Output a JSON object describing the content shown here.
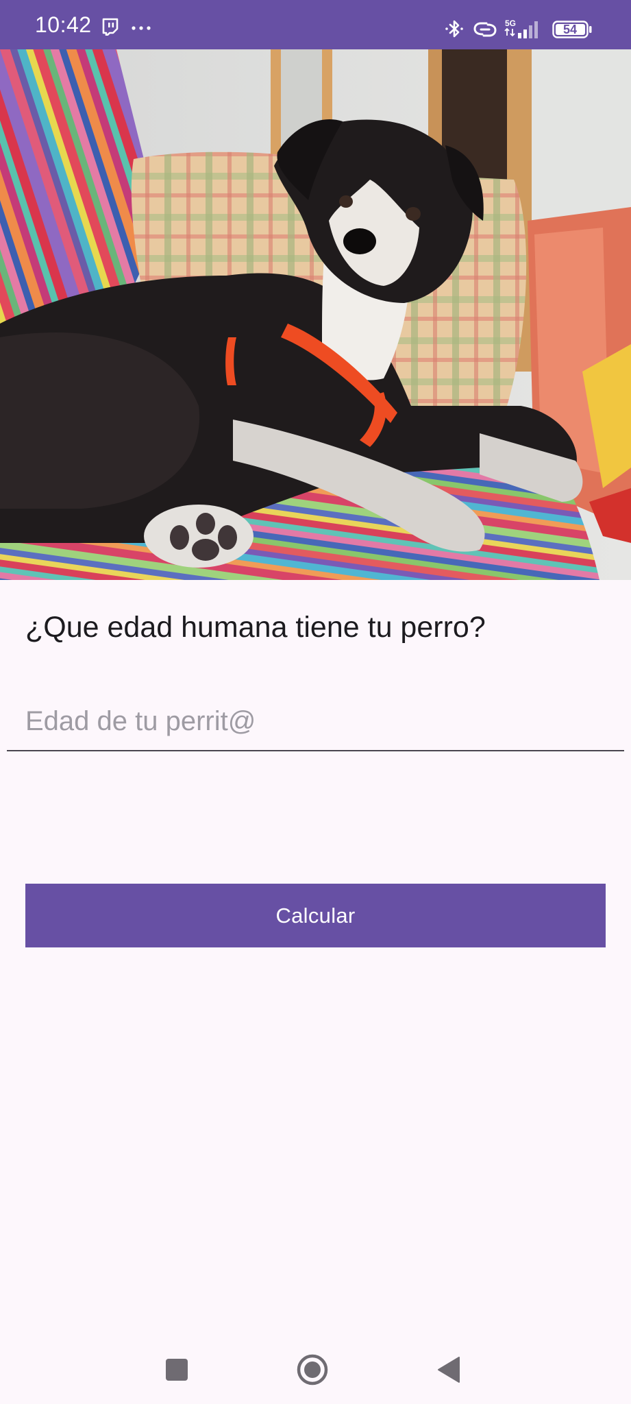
{
  "status_bar": {
    "time": "10:42",
    "network": "5G",
    "battery": "54",
    "icons": [
      "twitch-notification-icon",
      "more-dots-icon",
      "bluetooth-icon",
      "link-icon",
      "signal-icon",
      "battery-icon"
    ],
    "background_color": "#6750a4"
  },
  "photo": {
    "subject": "dog-photo"
  },
  "main": {
    "question": "¿Que edad humana tiene tu perro?",
    "input_placeholder": "Edad de tu perrit@",
    "input_value": "",
    "button_label": "Calcular",
    "accent_color": "#6750a4"
  },
  "nav_bar": {
    "icons": [
      "recents-square-icon",
      "home-circle-icon",
      "back-triangle-icon"
    ]
  }
}
